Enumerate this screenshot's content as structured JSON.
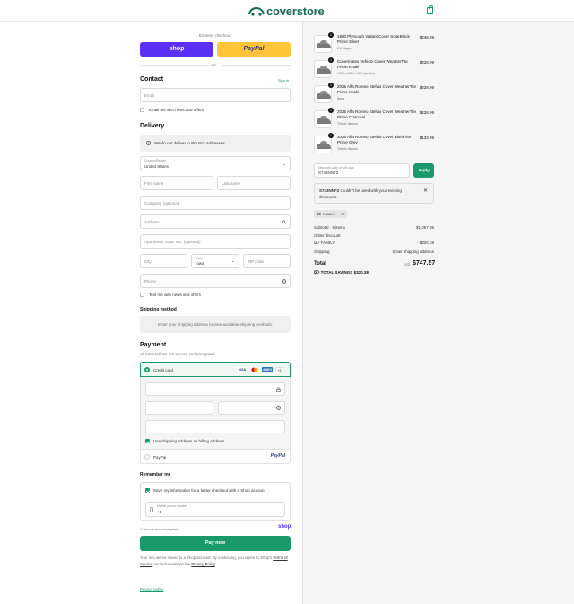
{
  "brand": {
    "name": "coverstore",
    "accent": "#1a9a6c"
  },
  "express": {
    "title": "Express checkout",
    "shop_label": "shop",
    "paypal_label": "PayPal",
    "or_label": "OR"
  },
  "contact": {
    "title": "Contact",
    "sign_in": "Sign in",
    "email_placeholder": "Email",
    "news_label": "Email me with news and offers"
  },
  "delivery": {
    "title": "Delivery",
    "notice": "We do not deliver to PO Box addresses.",
    "country_label": "Country/Region",
    "country_value": "United States",
    "first_name": "First name",
    "last_name": "Last name",
    "company": "Company (optional)",
    "address": "Address",
    "apartment": "Apartment, suite, etc. (optional)",
    "city": "City",
    "state_label": "State",
    "state_value": "Iowa",
    "zip": "ZIP code",
    "phone": "Phone",
    "text_me": "Text me with news and offers"
  },
  "shipping_method": {
    "title": "Shipping method",
    "notice": "Enter your shipping address to view available shipping methods."
  },
  "payment": {
    "title": "Payment",
    "subtitle": "All transactions are secure and encrypted.",
    "credit_card_label": "Credit card",
    "card_logos": [
      "VISA",
      "MC",
      "AMEX",
      "+3"
    ],
    "billing_same": "Use shipping address as billing address",
    "paypal_label": "PayPal"
  },
  "remember": {
    "title": "Remember me",
    "save_info": "Save my information for a faster checkout with a Shop account",
    "mobile_label": "Mobile phone number",
    "mobile_value": "+1",
    "secure": "Secure and encrypted",
    "shop_word": "shop"
  },
  "pay": {
    "button": "Pay now"
  },
  "legal": {
    "line1": "Your info will be saved to a Shop account. By continuing, you agree to Shop's",
    "terms": "Terms of Service",
    "mid": "and acknowledge the",
    "privacy": "Privacy Policy",
    "end": ".",
    "privacy_footer": "Privacy policy"
  },
  "cart": {
    "items": [
      {
        "qty": "1",
        "name": "1960 Plymouth Valiant Cover SolarBlock Prime Silver",
        "variant": "2/3 Wagon",
        "price": "$246.99"
      },
      {
        "qty": "1",
        "name": "Covermates Vehicle Cover WeatherTite Prime Khaki",
        "variant": "106L x 66W x 50H (inches)",
        "price": "$228.99"
      },
      {
        "qty": "1",
        "name": "2025 Alfa Romeo Stelvio Cover WeatherTite Prime Khaki",
        "variant": "Base",
        "price": "$228.99"
      },
      {
        "qty": "1",
        "name": "2025 Alfa Romeo Stelvio Cover WeatherTite Prime Charcoal",
        "variant": "Tributo Italiano",
        "price": "$228.99"
      },
      {
        "qty": "1",
        "name": "2025 Alfa Romeo Stelvio Cover BlockTite Prime Grey",
        "variant": "Tributo Italiano",
        "price": "$133.99"
      }
    ],
    "discount_label": "Discount code or gift card",
    "discount_value": "S743NNF2",
    "apply": "Apply",
    "error_code": "S743NNF2",
    "error_text": "couldn't be used with your existing discounts.",
    "chip": "FAMILY",
    "subtotal_label": "Subtotal · 5 items",
    "subtotal_value": "$1,067.95",
    "order_discount_label": "Order discount",
    "family_label": "FAMILY",
    "family_value": "- $320.38",
    "shipping_label": "Shipping",
    "shipping_value": "Enter shipping address",
    "total_label": "Total",
    "currency": "USD",
    "total_value": "$747.57",
    "savings_label": "TOTAL SAVINGS",
    "savings_value": "$320.38"
  }
}
